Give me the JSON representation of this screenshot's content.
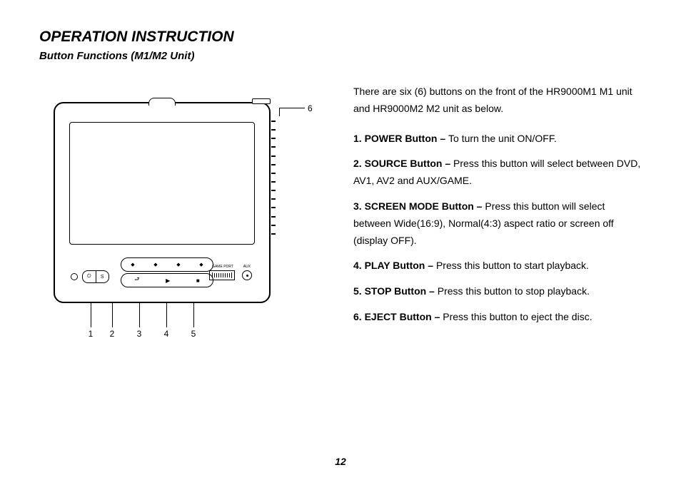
{
  "heading": "OPERATION INSTRUCTION",
  "subheading": "Button Functions (M1/M2 Unit)",
  "intro": "There are six (6) buttons on the front of the HR9000M1 M1 unit and HR9000M2 M2 unit as below.",
  "items": [
    {
      "num": "1.",
      "label": "POWER Button – ",
      "desc": "To turn the unit ON/OFF."
    },
    {
      "num": "2.",
      "label": "SOURCE Button – ",
      "desc": "Press this button will select between DVD, AV1, AV2 and AUX/GAME."
    },
    {
      "num": "3.",
      "label": "SCREEN MODE Button – ",
      "desc": "Press this button will select between Wide(16:9), Normal(4:3) aspect ratio or screen off (display OFF)."
    },
    {
      "num": "4.",
      "label": "PLAY Button – ",
      "desc": "Press this button to start playback."
    },
    {
      "num": "5.",
      "label": "STOP Button – ",
      "desc": "Press this button to stop playback."
    },
    {
      "num": "6.",
      "label": "EJECT Button – ",
      "desc": "Press this button to eject the disc."
    }
  ],
  "diagram": {
    "callouts": [
      "1",
      "2",
      "3",
      "4",
      "5",
      "6"
    ],
    "port_game": "GAME PORT",
    "port_aux": "AUX",
    "pair_left": "⏻",
    "pair_right": "S",
    "nav_bottom": [
      "⮐",
      "▶",
      "■"
    ]
  },
  "page_number": "12"
}
